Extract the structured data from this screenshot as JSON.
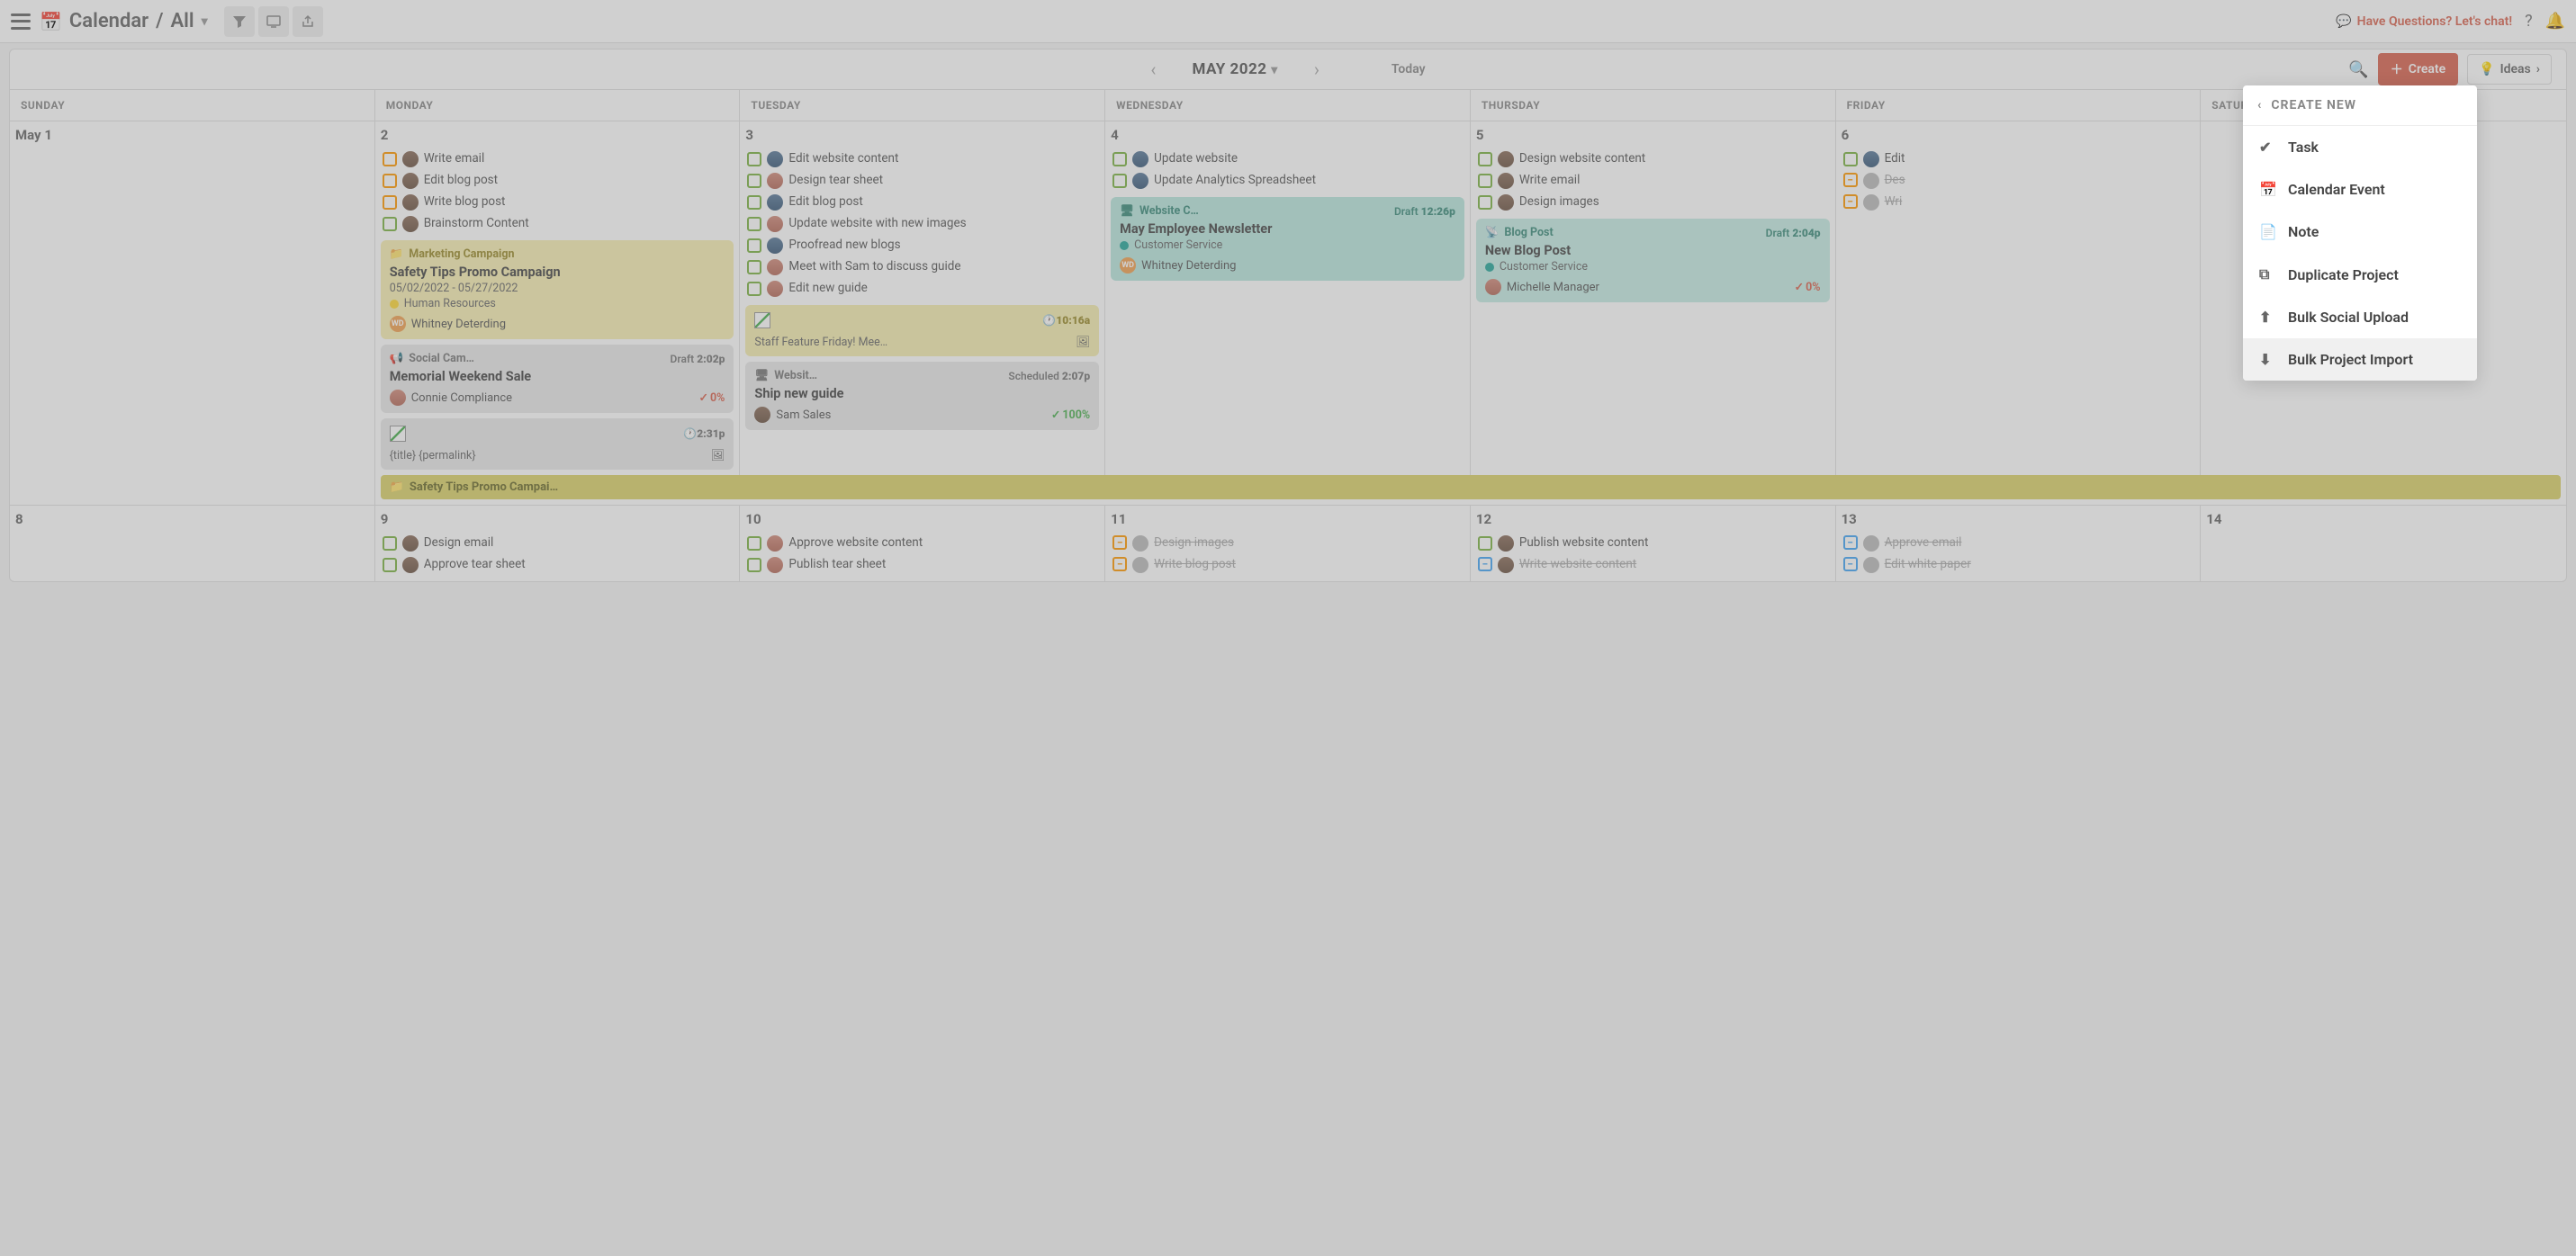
{
  "topbar": {
    "app": "Calendar",
    "view": "All",
    "chat": "Have Questions? Let's chat!"
  },
  "calHead": {
    "month": "MAY 2022",
    "today": "Today",
    "create": "Create",
    "ideas": "Ideas"
  },
  "days": [
    "SUNDAY",
    "MONDAY",
    "TUESDAY",
    "WEDNESDAY",
    "THURSDAY",
    "FRIDAY",
    "SATURDAY"
  ],
  "dropdown": {
    "title": "CREATE NEW",
    "items": [
      "Task",
      "Calendar Event",
      "Note",
      "Duplicate Project",
      "Bulk Social Upload",
      "Bulk Project Import"
    ]
  },
  "week1": {
    "sun": {
      "date": "May 1"
    },
    "mon": {
      "date": "2",
      "tasks": [
        {
          "c": "orange",
          "t": "Write email"
        },
        {
          "c": "orange",
          "t": "Edit blog post"
        },
        {
          "c": "orange",
          "t": "Write blog post"
        },
        {
          "c": "green",
          "t": "Brainstorm Content"
        }
      ],
      "campaign": {
        "tag": "Marketing Campaign",
        "title": "Safety Tips Promo Campaign",
        "dates": "05/02/2022 - 05/27/2022",
        "team": "Human Resources",
        "owner": "Whitney Deterding"
      },
      "social": {
        "tag": "Social Cam…",
        "status": "Draft",
        "time": "2:02p",
        "title": "Memorial Weekend Sale",
        "owner": "Connie Compliance",
        "pct": "0%"
      },
      "post": {
        "time": "2:31p",
        "line": "{title} {permalink}"
      }
    },
    "tue": {
      "date": "3",
      "tasks": [
        {
          "c": "green",
          "t": "Edit website content"
        },
        {
          "c": "green",
          "t": "Design tear sheet"
        },
        {
          "c": "green",
          "t": "Edit blog post"
        },
        {
          "c": "green",
          "t": "Update website with new images"
        },
        {
          "c": "green",
          "t": "Proofread new blogs"
        },
        {
          "c": "green",
          "t": "Meet with Sam to discuss guide"
        },
        {
          "c": "green",
          "t": "Edit new guide"
        }
      ],
      "staff": {
        "time": "10:16a",
        "title": "Staff Feature Friday! Mee…"
      },
      "ship": {
        "tag": "Websit…",
        "status": "Scheduled",
        "time": "2:07p",
        "title": "Ship new guide",
        "owner": "Sam Sales",
        "pct": "100%"
      }
    },
    "wed": {
      "date": "4",
      "tasks": [
        {
          "c": "green",
          "t": "Update website"
        },
        {
          "c": "green",
          "t": "Update Analytics Spreadsheet"
        }
      ],
      "news": {
        "tag": "Website C…",
        "status": "Draft",
        "time": "12:26p",
        "title": "May Employee Newsletter",
        "team": "Customer Service",
        "owner": "Whitney Deterding"
      }
    },
    "thu": {
      "date": "5",
      "tasks": [
        {
          "c": "green",
          "t": "Design website content"
        },
        {
          "c": "green",
          "t": "Write email"
        },
        {
          "c": "green",
          "t": "Design images"
        }
      ],
      "blog": {
        "tag": "Blog Post",
        "status": "Draft",
        "time": "2:04p",
        "title": "New Blog Post",
        "team": "Customer Service",
        "owner": "Michelle Manager",
        "pct": "0%"
      }
    },
    "fri": {
      "date": "6",
      "tasks": [
        {
          "c": "green",
          "t": "Edit"
        },
        {
          "c": "dash-or",
          "t": "Des",
          "strike": true
        },
        {
          "c": "dash-or",
          "t": "Wri",
          "strike": true
        }
      ]
    },
    "sat": {
      "date": ""
    }
  },
  "spanBar": "Safety Tips Promo Campai…",
  "week2": {
    "sun": {
      "date": "8"
    },
    "mon": {
      "date": "9",
      "tasks": [
        {
          "c": "green",
          "t": "Design email"
        },
        {
          "c": "green",
          "t": "Approve tear sheet"
        }
      ]
    },
    "tue": {
      "date": "10",
      "tasks": [
        {
          "c": "green",
          "t": "Approve website content"
        },
        {
          "c": "green",
          "t": "Publish tear sheet"
        }
      ]
    },
    "wed": {
      "date": "11",
      "tasks": [
        {
          "c": "dash-or",
          "t": "Design images",
          "strike": true
        },
        {
          "c": "dash-or",
          "t": "Write blog post",
          "strike": true
        }
      ]
    },
    "thu": {
      "date": "12",
      "tasks": [
        {
          "c": "green",
          "t": "Publish website content"
        },
        {
          "c": "dash-bl",
          "t": "Write website content",
          "strike": true
        }
      ]
    },
    "fri": {
      "date": "13",
      "tasks": [
        {
          "c": "dash-bl",
          "t": "Approve email",
          "strike": true
        },
        {
          "c": "dash-bl",
          "t": "Edit white paper",
          "strike": true
        }
      ]
    },
    "sat": {
      "date": "14"
    }
  }
}
